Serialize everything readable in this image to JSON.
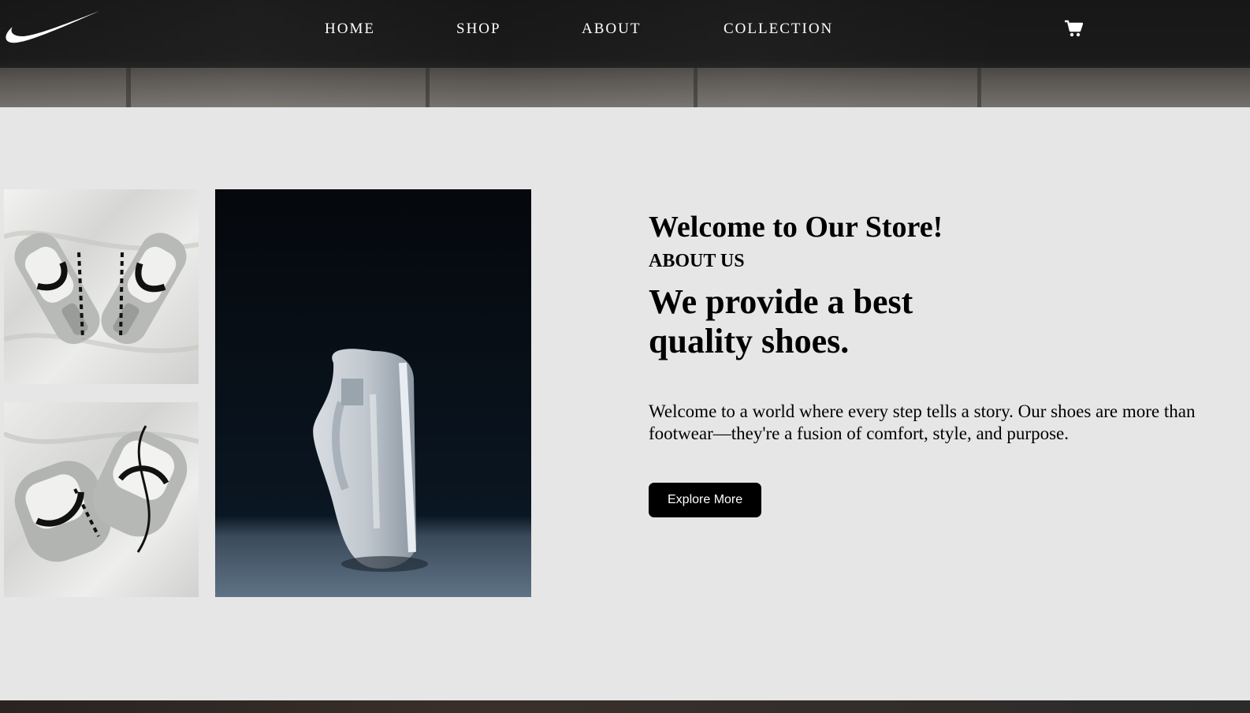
{
  "nav": {
    "logo": "nike-swoosh-logo",
    "links": [
      "HOME",
      "SHOP",
      "ABOUT",
      "COLLECTION"
    ],
    "cart_icon": "shopping-cart-icon"
  },
  "about": {
    "welcome_title": "Welcome to Our Store!",
    "section_label": "ABOUT US",
    "headline": "We provide a best quality shoes.",
    "description": "Welcome to a world where every step tells a story. Our shoes are more than footwear—they're a fusion of comfort, style, and purpose.",
    "button_label": "Explore More"
  },
  "gallery": {
    "images": [
      "sneakers-on-silk-top-view",
      "sneakers-on-silk-crossed-laces",
      "white-sneaker-dark-background"
    ]
  },
  "colors": {
    "page_background": "#e6e6e6",
    "header_background": "#1e1e1e",
    "button_background": "#000000",
    "button_text": "#ffffff"
  }
}
